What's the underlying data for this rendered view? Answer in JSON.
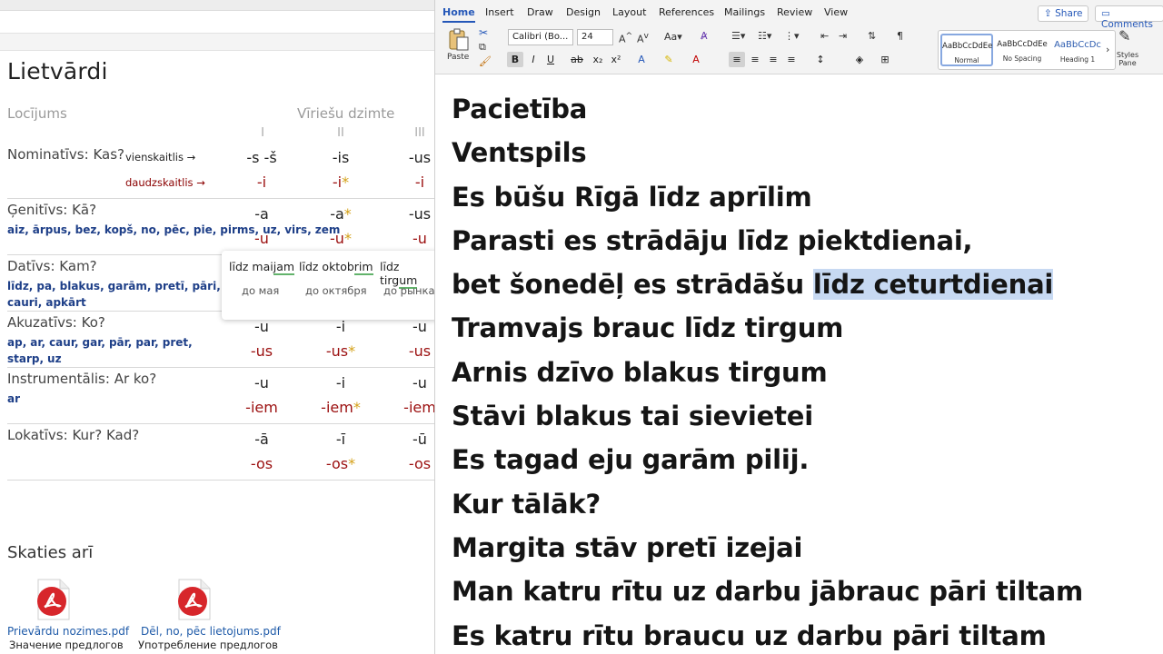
{
  "left": {
    "title": "Lietvārdi",
    "header": {
      "case_col": "Locījums",
      "gender": "Vīriešu dzimte",
      "roman": [
        "I",
        "II",
        "III"
      ]
    },
    "nominative": {
      "name": "Nominatīvs: Kas?",
      "singular_label": "vienskaitlis →",
      "plural_label": "daudzskaitlis →",
      "sing": [
        "-s -š",
        "-is",
        "-us"
      ],
      "plur": [
        "-i",
        "-i",
        "-i"
      ]
    },
    "genitive": {
      "name": "Ģenitīvs: Kā?",
      "sing": [
        "-a",
        "-a",
        "-us"
      ],
      "plur": [
        "-u",
        "-u",
        "-u"
      ],
      "preps": [
        "aiz,",
        "ārpus,",
        "bez,",
        "kopš,",
        "no,",
        "pēc,",
        "pie,",
        "pirms,",
        "uz,",
        "virs,",
        "zem"
      ]
    },
    "dative": {
      "name": "Datīvs: Kam?",
      "preps": [
        "līdz,",
        "pa,",
        "blakus,",
        "garām,",
        "pretī,",
        "pāri,",
        "cauri,",
        "apkārt"
      ]
    },
    "accusative": {
      "name": "Akuzatīvs: Ko?",
      "sing": [
        "-u",
        "-i",
        "-u"
      ],
      "plur": [
        "-us",
        "-us",
        "-us"
      ],
      "preps": [
        "ap,",
        "ar,",
        "caur,",
        "gar,",
        "pār,",
        "par,",
        "pret,",
        "starp,",
        "uz"
      ]
    },
    "instrumental": {
      "name": "Instrumentālis: Ar ko?",
      "sing": [
        "-u",
        "-i",
        "-u"
      ],
      "plur": [
        "-iem",
        "-iem",
        "-iem"
      ],
      "preps": [
        "ar"
      ]
    },
    "locative": {
      "name": "Lokatīvs: Kur? Kad?",
      "sing": [
        "-ā",
        "-ī",
        "-ū"
      ],
      "plur": [
        "-os",
        "-os",
        "-os"
      ]
    },
    "star": "*",
    "popup": {
      "words": [
        {
          "stem": "līdz mai",
          "ending": "jam",
          "translation": "до мая"
        },
        {
          "stem": "līdz oktob",
          "ending": "rim",
          "translation": "до октября"
        },
        {
          "stem": "līdz tirg",
          "ending": "um",
          "translation": "до рынка"
        }
      ]
    },
    "see_also": "Skaties arī",
    "files": [
      {
        "name": "Prievārdu nozimes.pdf",
        "desc": "Значение предлогов"
      },
      {
        "name": "Dēl, no, pēc lietojums.pdf",
        "desc": "Употребление предлогов"
      }
    ]
  },
  "word": {
    "tabs": [
      "Home",
      "Insert",
      "Draw",
      "Design",
      "Layout",
      "References",
      "Mailings",
      "Review",
      "View"
    ],
    "share": "Share",
    "comments": "Comments",
    "paste": "Paste",
    "font_name": "Calibri (Bo...",
    "font_size": "24",
    "styles": [
      {
        "sample": "AaBbCcDdEe",
        "name": "Normal"
      },
      {
        "sample": "AaBbCcDdEe",
        "name": "No Spacing"
      },
      {
        "sample": "AaBbCcDc",
        "name": "Heading 1"
      }
    ],
    "styles_pane": "Styles Pane",
    "lines": [
      {
        "text": "Pacietība"
      },
      {
        "text": "Ventspils"
      },
      {
        "text": "Es būšu Rīgā līdz aprīlim"
      },
      {
        "text": "Parasti es strādāju līdz piektdienai,"
      },
      {
        "text": "bet šonedēļ es strādāšu ",
        "highlight": "līdz ceturtdienai"
      },
      {
        "text": "Tramvajs brauc līdz tirgum"
      },
      {
        "text": "Arnis dzīvo blakus tirgum"
      },
      {
        "text": "Stāvi blakus tai sievietei"
      },
      {
        "text": "Es tagad eju garām pilij."
      },
      {
        "text": "Kur tālāk?"
      },
      {
        "text": "Margita stāv pretī izejai"
      },
      {
        "text": "Man katru rītu uz darbu jābrauc pāri tiltam"
      },
      {
        "text": "Es katru rītu braucu uz darbu pāri tiltam"
      }
    ]
  },
  "colors": {
    "accent": "#2457b8",
    "ending_red": "#9b0f0f",
    "star": "#d4a017",
    "prep_blue": "#1e3f88",
    "highlight": "#c7d9f2"
  }
}
